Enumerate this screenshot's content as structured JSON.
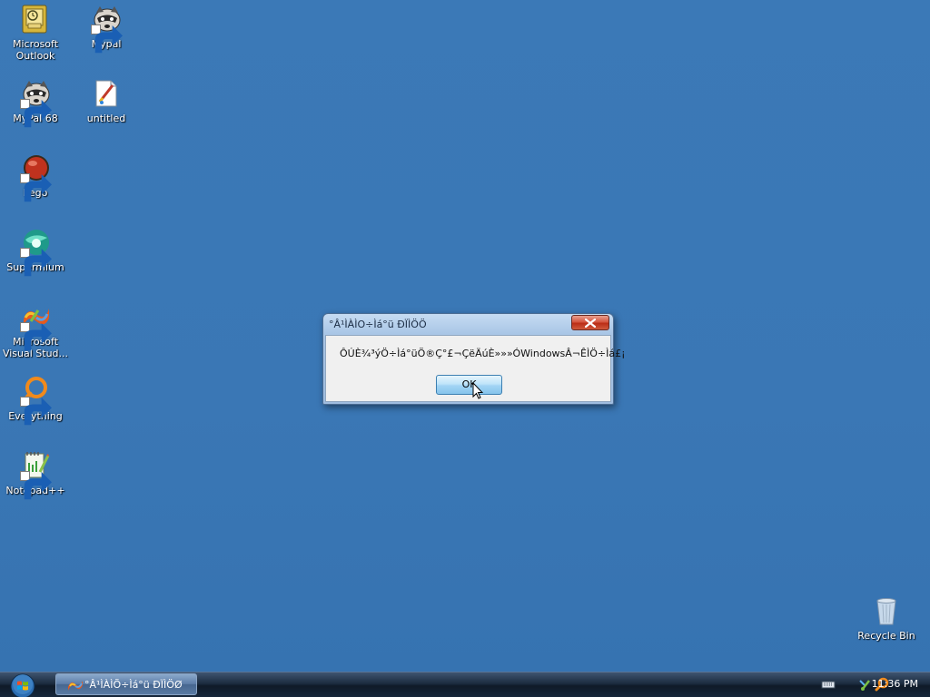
{
  "desktop": {
    "icons": [
      {
        "label_line1": "Microsoft",
        "label_line2": "Outlook",
        "icon": "outlook-icon"
      },
      {
        "label_line1": "Mypal",
        "label_line2": "",
        "icon": "mypal-raccoon-icon"
      },
      {
        "label_line1": "MyPal 68",
        "label_line2": "",
        "icon": "mypal-raccoon-icon"
      },
      {
        "label_line1": "untitled",
        "label_line2": "",
        "icon": "paint-document-icon"
      },
      {
        "label_line1": "Pego",
        "label_line2": "",
        "icon": "pego-red-ball-icon"
      },
      {
        "label_line1": "Supermium",
        "label_line2": "",
        "icon": "supermium-icon"
      },
      {
        "label_line1": "Microsoft",
        "label_line2": "Visual Stud...",
        "icon": "visual-studio-icon"
      },
      {
        "label_line1": "Everything",
        "label_line2": "",
        "icon": "everything-search-icon"
      },
      {
        "label_line1": "Notepad++",
        "label_line2": "",
        "icon": "notepadpp-icon"
      },
      {
        "label_line1": "Recycle Bin",
        "label_line2": "",
        "icon": "recycle-bin-icon"
      }
    ]
  },
  "dialog": {
    "title": "°Â¹ÌÀÌO÷Ìá°ü ÐÏÌÖÖ",
    "message": "ÔÚÈ¾³ýÖ÷Ìá°üÖ®Ç°£¬ÇëÄúÈ»»»ÓWindowsÂ¬ÊÌÖ÷Ìá£¡",
    "ok_label": "OK",
    "close_icon": "close-x-icon"
  },
  "taskbar": {
    "start_icon": "windows-start-orb-icon",
    "task_button_label": "°Â¹ÌÀÌÕ÷Ìá°ü ÐÏÌÖØ",
    "task_button_icon": "app-colorful-icon",
    "tray_icons": [
      "keyboard-icon",
      "network-icon",
      "search-magnifier-icon"
    ],
    "clock": "11:36 PM"
  },
  "colors": {
    "desktop_background": "#3a78b6",
    "taskbar": "#16263a",
    "dialog_frame": "#a9c6e6",
    "close_button": "#c8452e",
    "ok_button": "#a2d4f4"
  }
}
